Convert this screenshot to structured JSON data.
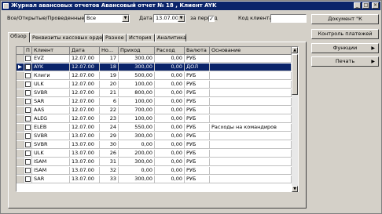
{
  "title": "Журнал авансовых отчетов Авансовый отчет № 18 , Клиент AYK",
  "window_buttons": [
    "_",
    "□",
    "×"
  ],
  "filter": {
    "type_label": "Все/Открытые/Проведенные",
    "type_value": "Все",
    "date_label": "Дата",
    "date_value": "13.07.00",
    "period_label": "за период",
    "period_checked": true,
    "client_code_label": "Код клиента",
    "client_code_value": ""
  },
  "buttons": {
    "document": "Документ \"К",
    "payment_control": "Контроль платежей",
    "functions": "Функции",
    "print": "Печать"
  },
  "tabs": [
    "Обзор",
    "Реквизиты кассовых ордеров",
    "Разное",
    "История",
    "Аналитика"
  ],
  "grid": {
    "headers": [
      "П",
      "Клиент",
      "Дата",
      "Но...",
      "Приход",
      "Расход",
      "Валюта",
      "Основание"
    ],
    "rows": [
      {
        "client": "EVZ",
        "date": "12.07.00",
        "no": "17",
        "income": "300,00",
        "expense": "0,00",
        "currency": "РУБ",
        "basis": "",
        "selected": false
      },
      {
        "client": "AYK",
        "date": "12.07.00",
        "no": "18",
        "income": "300,00",
        "expense": "0,00",
        "currency": "ДОЛ",
        "basis": "",
        "selected": true
      },
      {
        "client": "Клиги",
        "date": "12.07.00",
        "no": "19",
        "income": "500,00",
        "expense": "0,00",
        "currency": "РУБ",
        "basis": "",
        "selected": false
      },
      {
        "client": "ULK",
        "date": "12.07.00",
        "no": "20",
        "income": "100,00",
        "expense": "0,00",
        "currency": "РУБ",
        "basis": "",
        "selected": false
      },
      {
        "client": "SVBR",
        "date": "12.07.00",
        "no": "21",
        "income": "800,00",
        "expense": "0,00",
        "currency": "РУБ",
        "basis": "",
        "selected": false
      },
      {
        "client": "SAR",
        "date": "12.07.00",
        "no": "6",
        "income": "100,00",
        "expense": "0,00",
        "currency": "РУБ",
        "basis": "",
        "selected": false
      },
      {
        "client": "AAS",
        "date": "12.07.00",
        "no": "22",
        "income": "700,00",
        "expense": "0,00",
        "currency": "РУБ",
        "basis": "",
        "selected": false
      },
      {
        "client": "ALEG",
        "date": "12.07.00",
        "no": "23",
        "income": "100,00",
        "expense": "0,00",
        "currency": "РУБ",
        "basis": "",
        "selected": false
      },
      {
        "client": "ELEB",
        "date": "12.07.00",
        "no": "24",
        "income": "550,00",
        "expense": "0,00",
        "currency": "РУБ",
        "basis": "Расходы на командиров",
        "selected": false
      },
      {
        "client": "SVBR",
        "date": "13.07.00",
        "no": "29",
        "income": "300,00",
        "expense": "0,00",
        "currency": "РУБ",
        "basis": "",
        "selected": false
      },
      {
        "client": "SVBR",
        "date": "13.07.00",
        "no": "30",
        "income": "0,00",
        "expense": "0,00",
        "currency": "РУБ",
        "basis": "",
        "selected": false
      },
      {
        "client": "ULK",
        "date": "13.07.00",
        "no": "26",
        "income": "200,00",
        "expense": "0,00",
        "currency": "РУБ",
        "basis": "",
        "selected": false
      },
      {
        "client": "ISAM",
        "date": "13.07.00",
        "no": "31",
        "income": "300,00",
        "expense": "0,00",
        "currency": "РУБ",
        "basis": "",
        "selected": false
      },
      {
        "client": "ISAM",
        "date": "13.07.00",
        "no": "32",
        "income": "0,00",
        "expense": "0,00",
        "currency": "РУБ",
        "basis": "",
        "selected": false
      },
      {
        "client": "SAR",
        "date": "13.07.00",
        "no": "33",
        "income": "300,00",
        "expense": "0,00",
        "currency": "РУБ",
        "basis": "",
        "selected": false
      }
    ]
  },
  "icons": [
    "window-icon",
    "dropdown-arrow-icon",
    "calendar-dropdown-icon",
    "checkmark-icon",
    "row-pointer-icon",
    "scroll-up-icon",
    "scroll-down-icon",
    "submenu-arrow-icon"
  ]
}
